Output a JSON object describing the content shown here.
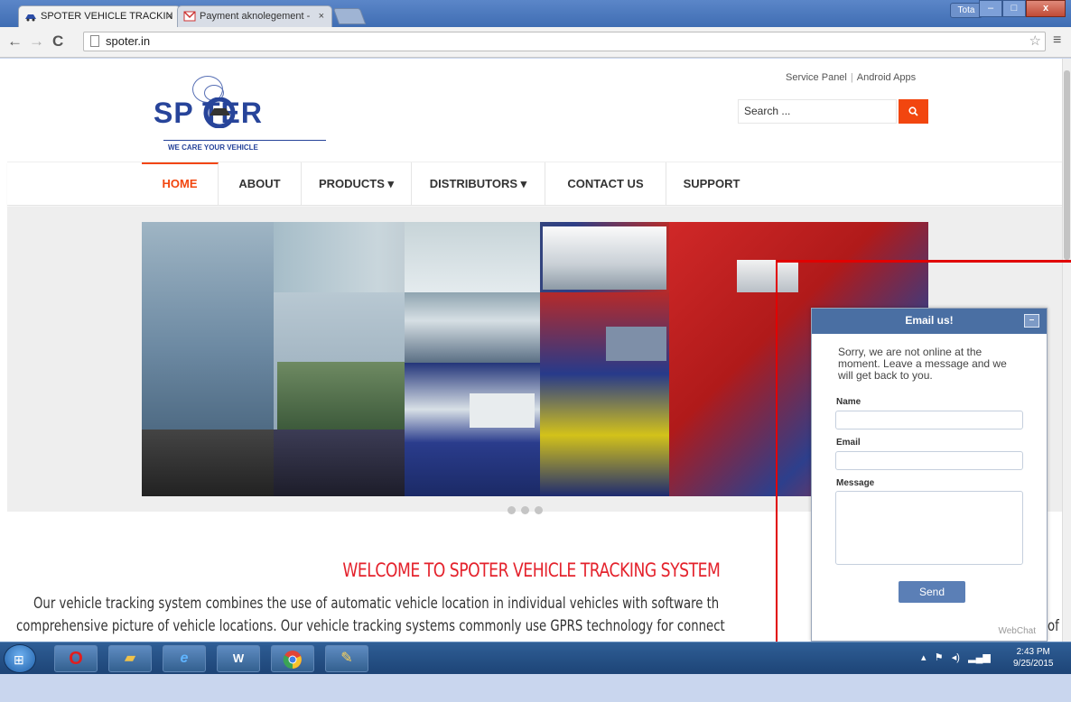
{
  "browser": {
    "tabs": [
      {
        "title": "SPOTER VEHICLE TRACKIN",
        "close": "×"
      },
      {
        "title": "Payment aknolegement -",
        "close": "×"
      }
    ],
    "profile": "Tota",
    "url": "spoter.in",
    "controls": {
      "minimize": "–",
      "maximize": "□",
      "close": "x"
    }
  },
  "site": {
    "logo_text": "SP   TER",
    "logo_tagline": "WE CARE YOUR VEHICLE",
    "top_links": [
      "Service Panel",
      "Android Apps"
    ],
    "search_placeholder": "Search ...",
    "nav": [
      {
        "label": "HOME",
        "active": true
      },
      {
        "label": "ABOUT"
      },
      {
        "label": "PRODUCTS ▾"
      },
      {
        "label": "DISTRIBUTORS ▾"
      },
      {
        "label": "CONTACT US"
      },
      {
        "label": "SUPPORT"
      }
    ],
    "welcome_title": "WELCOME TO SPOTER VEHICLE TRACKING SYSTEM",
    "welcome_lines": [
      "Our vehicle tracking system combines the use of automatic vehicle location in individual vehicles with software th",
      "comprehensive picture of vehicle locations. Our vehicle tracking systems commonly use GPRS technology for connect"
    ],
    "welcome_tail": "of",
    "slider_dots": 3
  },
  "chat": {
    "title": "Email us!",
    "minimize": "–",
    "message": "Sorry, we are not online at the moment. Leave a message and we will get back to you.",
    "name_label": "Name",
    "email_label": "Email",
    "message_label": "Message",
    "send": "Send",
    "brand": "WebChat"
  },
  "taskbar": {
    "time": "2:43 PM",
    "date": "9/25/2015"
  },
  "colors": {
    "accent": "#f2460f",
    "brand_blue": "#27449a",
    "welcome_red": "#e4222c",
    "chat_blue": "#4a6fa3"
  }
}
